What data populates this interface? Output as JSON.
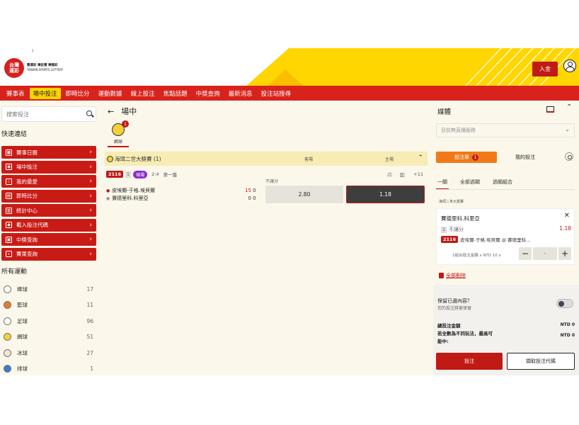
{
  "header": {
    "logo_text": "台灣\n運彩",
    "logo_line1": "賽運彩 樂註賽 樂賭彩",
    "logo_line2": "TAIWAN SPORTS LOTTERY",
    "deposit_label": "入金",
    "corner_mark": "1"
  },
  "nav": {
    "items": [
      "賽事表",
      "場中投注",
      "即時比分",
      "運動數據",
      "線上投注",
      "焦點話題",
      "中獎查詢",
      "最新消息",
      "投注站搜尋"
    ],
    "active_index": 1
  },
  "sidebar": {
    "search_placeholder": "搜索投注",
    "quick_title": "快速連結",
    "quick_links": [
      "賽事日曆",
      "場中投注",
      "我的最愛",
      "即時比分",
      "統計中心",
      "載入投注代碼",
      "中獎查詢",
      "賽果查詢"
    ],
    "sports_title": "所有運動",
    "sports": [
      {
        "name": "棒球",
        "count": "17"
      },
      {
        "name": "籃球",
        "count": "11"
      },
      {
        "name": "足球",
        "count": "96"
      },
      {
        "name": "網球",
        "count": "51"
      },
      {
        "name": "冰球",
        "count": "27"
      },
      {
        "name": "排球",
        "count": "1"
      }
    ]
  },
  "main": {
    "title": "場中",
    "sport_tab": {
      "label": "網球",
      "badge": "1"
    },
    "league": {
      "name": "海珥二世大獎賽 (1)",
      "away_label": "客場",
      "home_label": "主場"
    },
    "match": {
      "code": "2116",
      "sq": "1",
      "live_tag": "現場",
      "score_summary": "2:4",
      "period": "第一盤",
      "more": "+11",
      "team1": "皮埃爾-于格.埃貝爾",
      "team2": "賽德里科.科里亞",
      "team1_scores": [
        "15",
        "0"
      ],
      "team2_scores": [
        "0",
        "0"
      ],
      "market_label": "不讓分",
      "odds_away": "2.80",
      "odds_home": "1.18"
    }
  },
  "right": {
    "media_title": "媒體",
    "live_select": "目前無直播服務",
    "tab_bet": "投注單",
    "tab_bet_badge": "1",
    "tab_mine": "我的投注",
    "subtabs": [
      "一關",
      "全部過關",
      "過關組合"
    ],
    "slip": {
      "league": "海珥二世大獎賽",
      "selection": "賽德里科.科里亞",
      "market_sq": "1",
      "market": "不讓分",
      "price": "1.18",
      "code": "2116",
      "match": "皮埃爾-于格.埃貝爾 @ 賽德里科...",
      "stake_note": "1組合投注金額 x NTD 10 x",
      "minus": "−",
      "stake_value": "-",
      "plus": "+"
    },
    "clear_all": "全部刪除",
    "keep_title": "保留已選內容？",
    "keep_sub": "您的投注將被保留",
    "total_label": "總投注金額",
    "total_value": "NTD 0",
    "max_label1": "若全數為不同玩法，最高可",
    "max_label2": "能中:",
    "max_value": "NTD 0",
    "place_btn": "投注",
    "agent_btn": "擷取投注代碼"
  }
}
